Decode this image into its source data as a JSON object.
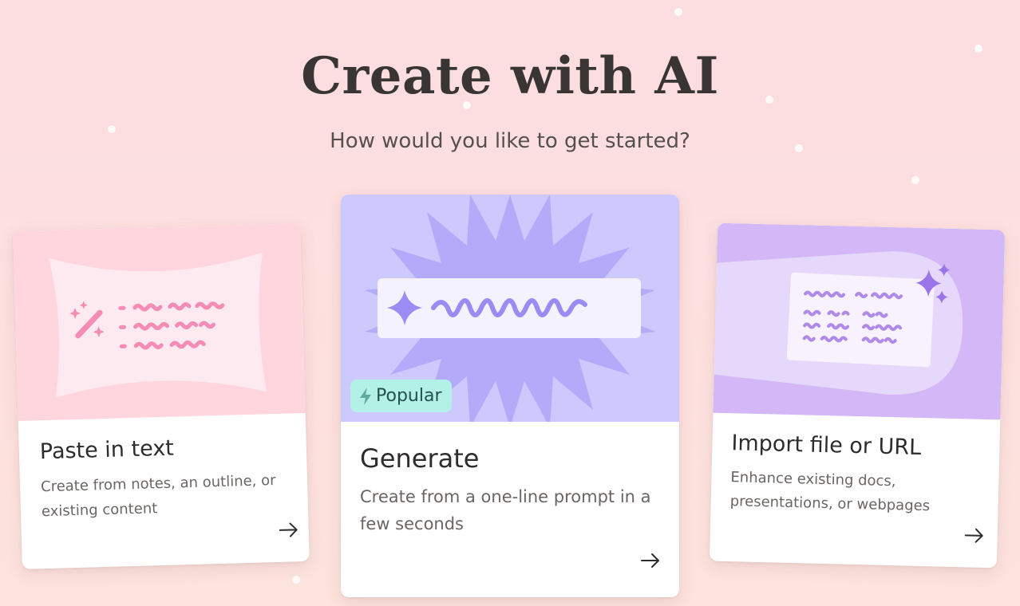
{
  "header": {
    "title": "Create with AI",
    "subtitle": "How would you like to get started?"
  },
  "cards": [
    {
      "title": "Paste in text",
      "description": "Create from notes, an outline, or existing content",
      "accent": "#f48cb6"
    },
    {
      "title": "Generate",
      "description": "Create from a one-line prompt in a few seconds",
      "badge": "Popular",
      "accent": "#9b8cf5"
    },
    {
      "title": "Import file or URL",
      "description": "Enhance existing docs, presentations, or webpages",
      "accent": "#b08ae8"
    }
  ],
  "icons": {
    "arrow": "arrow-right-icon",
    "badge": "lightning-icon",
    "wand": "magic-wand-icon",
    "sparkle": "sparkle-icon"
  },
  "colors": {
    "background": "#fcdde0",
    "badge_bg": "#b3f0e6",
    "title_text": "#383534"
  }
}
